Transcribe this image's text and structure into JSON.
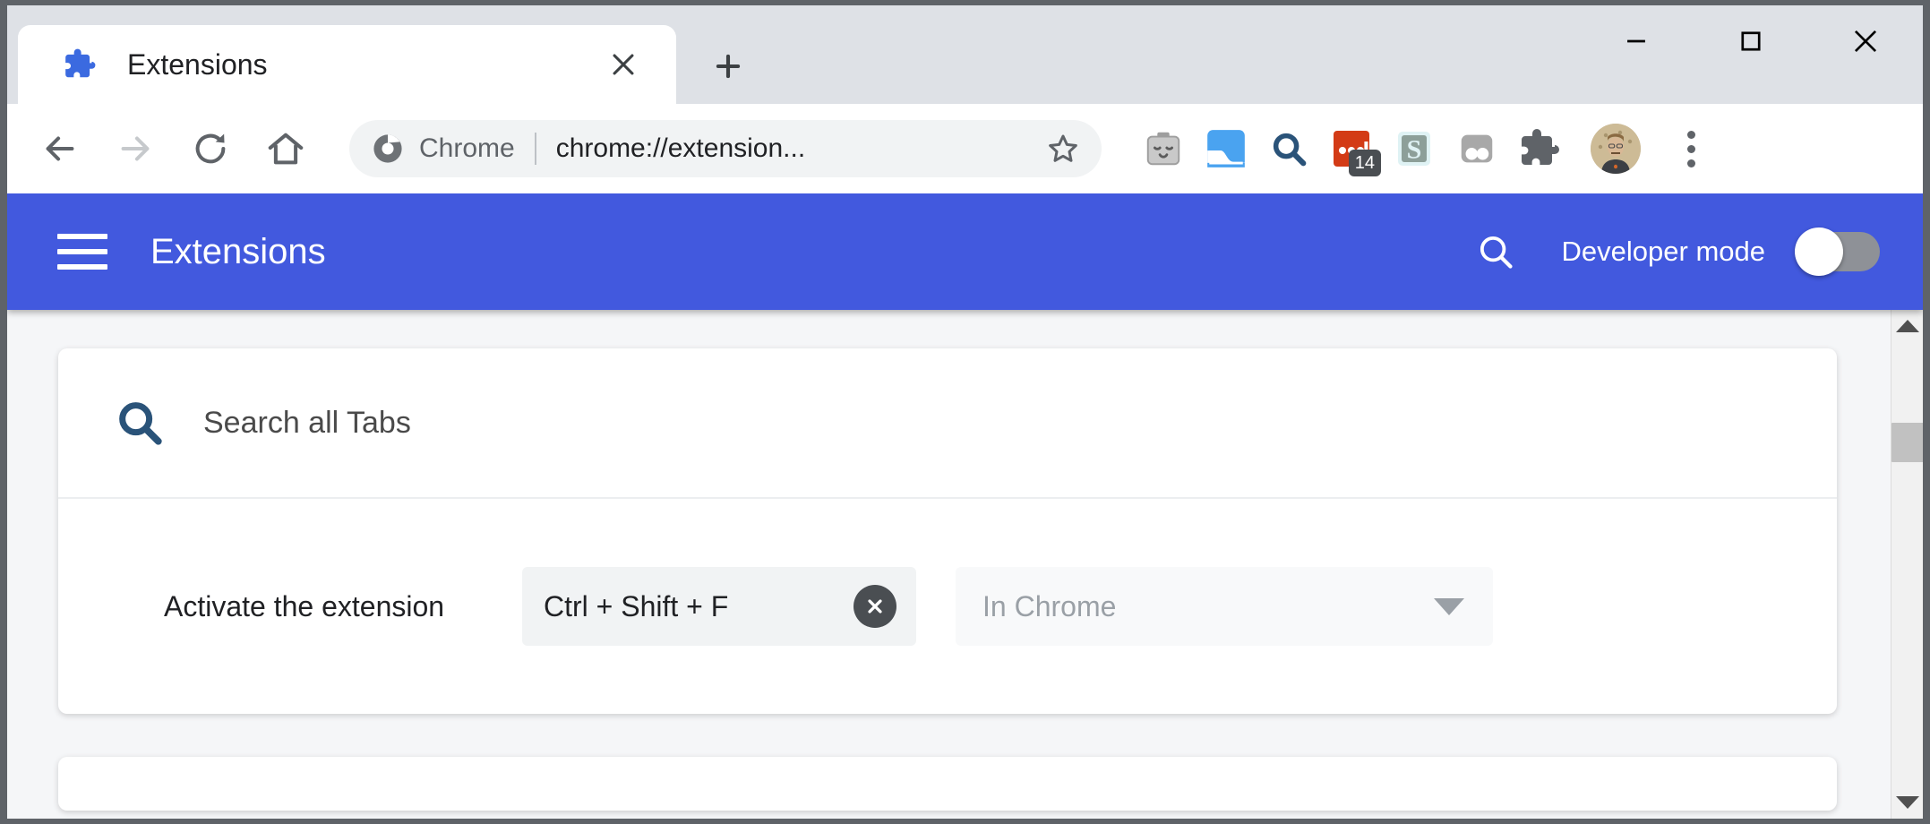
{
  "window": {
    "controls": {
      "minimize": "minimize-icon",
      "maximize": "maximize-icon",
      "close": "close-icon"
    }
  },
  "tabstrip": {
    "tabs": [
      {
        "title": "Extensions",
        "favicon": "puzzle-piece-icon",
        "active": true,
        "close_label": "✕"
      }
    ],
    "new_tab_label": "+"
  },
  "toolbar": {
    "back": "back-arrow-icon",
    "forward": "forward-arrow-icon",
    "reload": "reload-icon",
    "home": "home-icon",
    "omnibox": {
      "scheme_label": "Chrome",
      "url": "chrome://extension...",
      "bookmark": "star-outline-icon",
      "chrome_icon": "chrome-logo-icon"
    },
    "extension_icons": [
      {
        "name": "robot-toaster-extension-icon",
        "badge": ""
      },
      {
        "name": "blue-wave-extension-icon",
        "badge": ""
      },
      {
        "name": "search-extension-icon",
        "badge": ""
      },
      {
        "name": "red-dots-extension-icon",
        "badge": "14"
      },
      {
        "name": "s-letter-extension-icon",
        "badge": ""
      },
      {
        "name": "two-circles-extension-icon",
        "badge": ""
      },
      {
        "name": "extensions-puzzle-icon",
        "badge": ""
      }
    ],
    "avatar": "profile-avatar",
    "menu": "three-dots-menu-icon"
  },
  "extensions_page": {
    "header": {
      "menu_icon": "hamburger-menu-icon",
      "title": "Extensions",
      "search_icon": "search-icon",
      "developer_mode_label": "Developer mode",
      "developer_mode_enabled": false
    },
    "card": {
      "search_icon": "search-icon",
      "title": "Search all Tabs",
      "shortcuts": [
        {
          "name": "Activate the extension",
          "value": "Ctrl + Shift + F",
          "clear_label": "✕",
          "scope": "In Chrome"
        }
      ]
    }
  },
  "colors": {
    "header_blue": "#4259de",
    "page_background": "#f5f6f8",
    "card_background": "#ffffff",
    "input_background": "#f1f3f4",
    "muted_text": "#9aa0a6"
  }
}
